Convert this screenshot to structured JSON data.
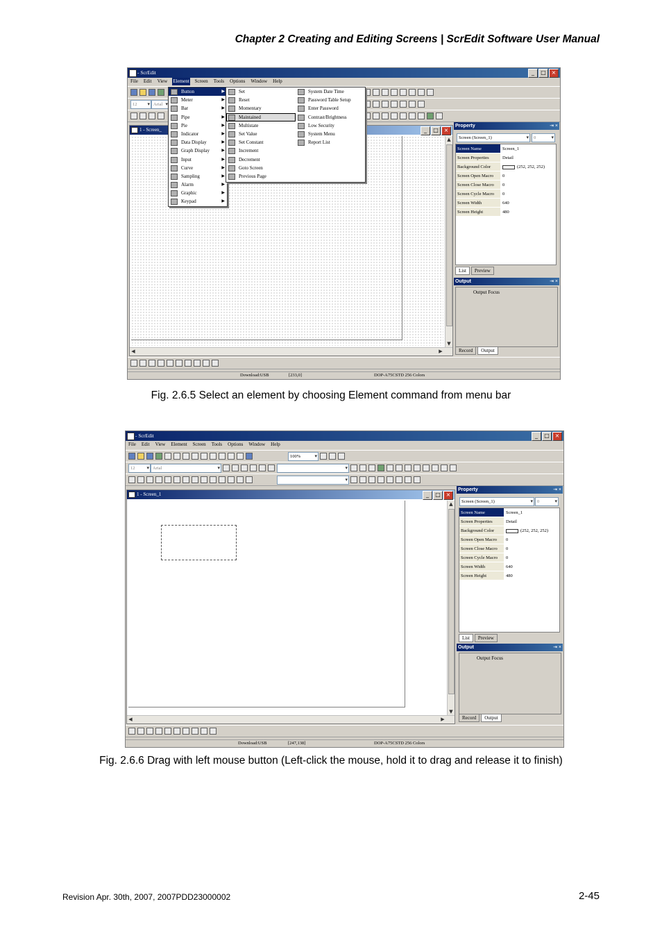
{
  "header": "Chapter 2  Creating and Editing Screens | ScrEdit Software User Manual",
  "fig1": {
    "caption": "Fig. 2.6.5 Select an element by choosing Element command from menu bar",
    "window_title": "- ScrEdit",
    "menus": [
      "File",
      "Edit",
      "View",
      "Element",
      "Screen",
      "Tools",
      "Options",
      "Window",
      "Help"
    ],
    "font_combo": "Arial",
    "size_combo": "12",
    "screen_title": "1 - Screen_",
    "element_menu": [
      "Button",
      "Meter",
      "Bar",
      "Pipe",
      "Pie",
      "Indicator",
      "Data Display",
      "Graph Display",
      "Input",
      "Curve",
      "Sampling",
      "Alarm",
      "Graphic",
      "Keypad"
    ],
    "button_submenu": [
      "Set",
      "Reset",
      "Momentary",
      "Maintained",
      "Multistate",
      "Set Value",
      "Set Constant",
      "Increment",
      "Decrement",
      "Goto Screen",
      "Previous Page"
    ],
    "button_submenu2": [
      "System Date Time",
      "Password Table Setup",
      "Enter Password",
      "Contrast/Brightness",
      "Low Security",
      "System Menu",
      "Report List"
    ],
    "status": {
      "download": "Download:USB",
      "coords": "[233,0]",
      "model": "DOP-A75CSTD 256 Colors"
    }
  },
  "fig2": {
    "caption": "Fig. 2.6.6 Drag with left mouse button (Left-click the mouse, hold it to drag and release it to finish)",
    "window_title": "- ScrEdit",
    "menus": [
      "File",
      "Edit",
      "View",
      "Element",
      "Screen",
      "Tools",
      "Options",
      "Window",
      "Help"
    ],
    "zoom": "100%",
    "font_combo": "Arial",
    "size_combo": "12",
    "screen_title": "1 - Screen_1",
    "status": {
      "download": "Download:USB",
      "coords": "[247,138]",
      "model": "DOP-A75CSTD 256 Colors"
    }
  },
  "property": {
    "title": "Property",
    "combo": "Screen (Screen_1)",
    "spin": "0",
    "rows": [
      {
        "k": "Screen Name",
        "v": "Screen_1"
      },
      {
        "k": "Screen Properties",
        "v": "Detail"
      },
      {
        "k": "Background Color",
        "v": "(252, 252, 252)"
      },
      {
        "k": "Screen Open Macro",
        "v": "0"
      },
      {
        "k": "Screen Close Macro",
        "v": "0"
      },
      {
        "k": "Screen Cycle Macro",
        "v": "0"
      },
      {
        "k": "Screen Width",
        "v": "640"
      },
      {
        "k": "Screen Height",
        "v": "480"
      }
    ],
    "tab_list": "List",
    "tab_preview": "Preview"
  },
  "output": {
    "title": "Output",
    "focus": "Output Focus",
    "tab_record": "Record",
    "tab_output": "Output"
  },
  "footer": {
    "left": "Revision Apr. 30th, 2007, 2007PDD23000002",
    "right": "2-45"
  }
}
